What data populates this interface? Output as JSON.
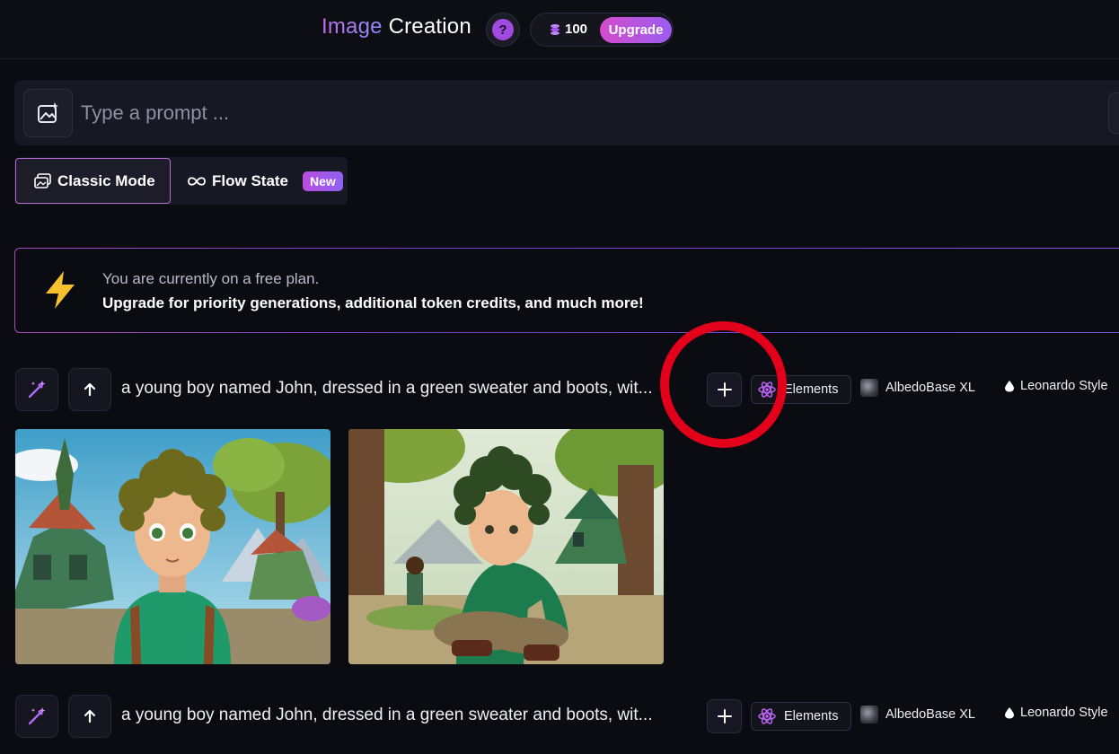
{
  "header": {
    "title_part1": "Image",
    "title_part2": "Creation",
    "help_icon": "question-icon",
    "token_count": "100",
    "upgrade_label": "Upgrade"
  },
  "prompt": {
    "placeholder": "Type a prompt ...",
    "icon": "image-sparkle-icon"
  },
  "modes": {
    "classic_label": "Classic Mode",
    "flow_label": "Flow State",
    "new_badge": "New"
  },
  "banner": {
    "line1": "You are currently on a free plan.",
    "line2": "Upgrade for priority generations, additional token credits, and much more!"
  },
  "generations": [
    {
      "prompt": "a young boy named John, dressed in a green sweater and boots, wit...",
      "elements_label": "Elements",
      "model": "AlbedoBase XL",
      "style": "Leonardo Style"
    },
    {
      "prompt": "a young boy named John, dressed in a green sweater and boots, wit...",
      "elements_label": "Elements",
      "model": "AlbedoBase XL",
      "style": "Leonardo Style"
    }
  ],
  "colors": {
    "accent_purple": "#a14ae0",
    "annotation_red": "#e3001a"
  }
}
